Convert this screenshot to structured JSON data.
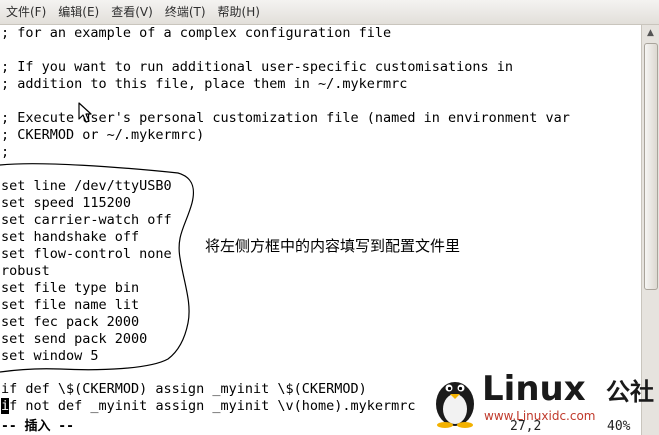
{
  "menu": {
    "items": [
      {
        "label": "文件(F)"
      },
      {
        "label": "编辑(E)"
      },
      {
        "label": "查看(V)"
      },
      {
        "label": "终端(T)"
      },
      {
        "label": "帮助(H)"
      }
    ]
  },
  "editor": {
    "lines": [
      "; for an example of a complex configuration file",
      "",
      "; If you want to run additional user-specific customisations in",
      "; addition to this file, place them in ~/.mykermrc",
      "",
      "; Execute user's personal customization file (named in environment var",
      "; CKERMOD or ~/.mykermrc)",
      ";",
      "",
      "set line /dev/ttyUSB0",
      "set speed 115200",
      "set carrier-watch off",
      "set handshake off",
      "set flow-control none",
      "robust",
      "set file type bin",
      "set file name lit",
      "set fec pack 2000",
      "set send pack 2000",
      "set window 5",
      "",
      "",
      "if def \\$(CKERMOD) assign _myinit \\$(CKERMOD)"
    ],
    "cursor_line": {
      "cursor_char": "i",
      "rest": "f not def _myinit assign _myinit \\v(home).mykermrc"
    }
  },
  "annotation": {
    "text": "将左侧方框中的内容填写到配置文件里"
  },
  "status": {
    "mode": "-- 插入 --",
    "position": "27,2",
    "percent": "40%"
  },
  "watermark": {
    "title": "Linux",
    "suffix": "公社",
    "url": "www.Linuxidc.com"
  },
  "colors": {
    "menubar": "#e9e7e3",
    "annotation_outline": "#000000",
    "watermark_text": "#1a1a1a"
  },
  "icons": {
    "pointer": "mouse-pointer-icon",
    "penguin": "tux-penguin-icon"
  }
}
